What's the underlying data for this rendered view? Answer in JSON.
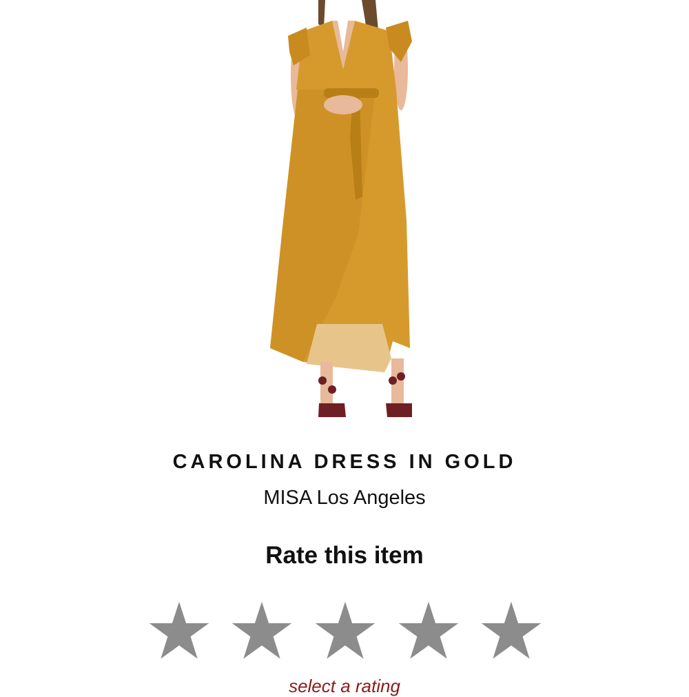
{
  "product": {
    "title": "CAROLINA DRESS IN GOLD",
    "brand": "MISA Los Angeles",
    "image_alt": "gold velvet wrap dress"
  },
  "rating": {
    "heading": "Rate this item",
    "hint": "select a rating",
    "max_stars": 5,
    "selected": 0,
    "star_icon": "star-icon",
    "star_color": "#8c8c8c",
    "hint_color": "#8b1a1a"
  },
  "colors": {
    "dress_gold": "#d69a2c",
    "dress_shadow": "#b87f17",
    "dress_lining": "#e7c58a",
    "skin": "#e8b99a",
    "hair": "#6b4a2e",
    "shoe": "#6e1f24"
  }
}
